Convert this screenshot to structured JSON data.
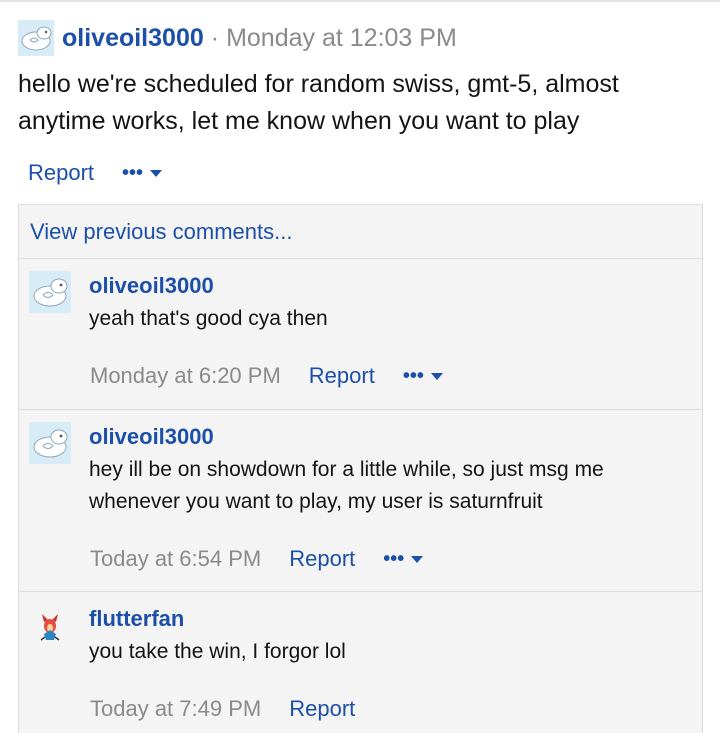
{
  "post": {
    "author": "oliveoil3000",
    "separator": "·",
    "timestamp": "Monday at 12:03 PM",
    "body": "hello we're scheduled for random swiss, gmt-5, almost anytime works, let me know when you want to play",
    "report_label": "Report",
    "more_label": "•••"
  },
  "comments_section": {
    "view_previous_label": "View previous comments...",
    "items": [
      {
        "author": "oliveoil3000",
        "text": "yeah that's good cya then",
        "timestamp": "Monday at 6:20 PM",
        "report_label": "Report",
        "more_label": "•••"
      },
      {
        "author": "oliveoil3000",
        "text": "hey ill be on showdown for a little while, so just msg me whenever you want to play, my user is saturnfruit",
        "timestamp": "Today at 6:54 PM",
        "report_label": "Report",
        "more_label": "•••"
      },
      {
        "author": "flutterfan",
        "text": "you take the win, I forgor lol",
        "timestamp": "Today at 7:49 PM",
        "report_label": "Report"
      }
    ]
  },
  "colors": {
    "link": "#1c4fa8",
    "meta": "#8a8a8a",
    "panel": "#f4f4f4",
    "border": "#dcdcdc"
  },
  "icons": {
    "oliveoil_avatar": "cloud-sheep-avatar",
    "flutterfan_avatar": "sprite-avatar",
    "more_menu": "chevron-down-icon"
  }
}
